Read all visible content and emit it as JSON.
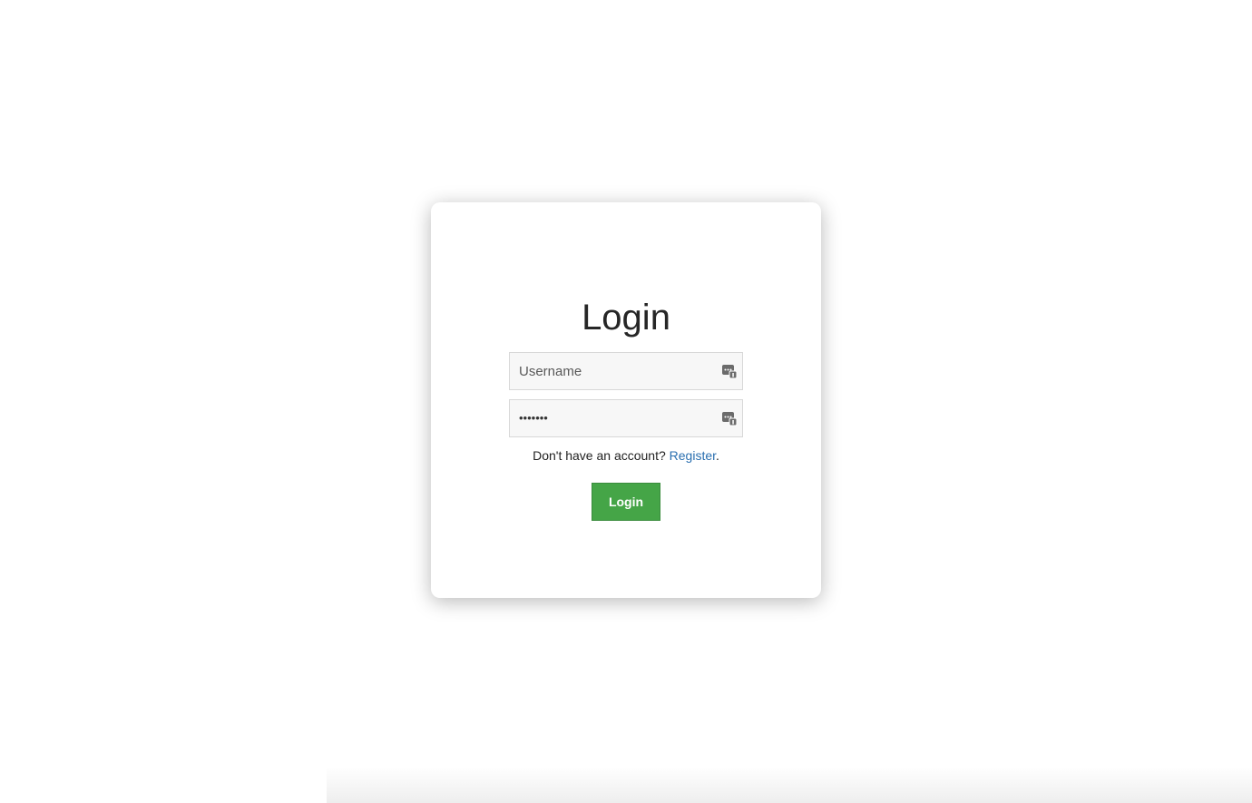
{
  "login_form": {
    "title": "Login",
    "username": {
      "placeholder": "Username",
      "value": ""
    },
    "password": {
      "masked_value": "•••••••"
    },
    "register_prompt": "Don't have an account?",
    "register_link": "Register",
    "register_suffix": ".",
    "submit_label": "Login"
  },
  "icons": {
    "field_icon": "password-manager-key-icon"
  },
  "colors": {
    "submit_background": "#45a547",
    "link": "#2a6fb0",
    "field_background": "#f7f7f7"
  }
}
